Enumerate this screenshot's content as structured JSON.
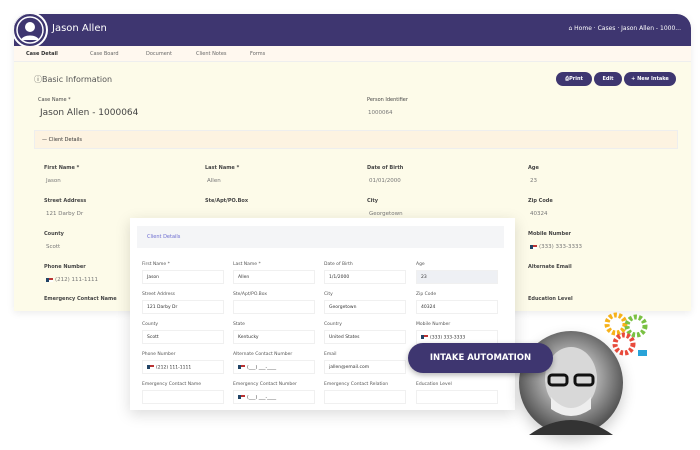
{
  "header": {
    "title": "Jason Allen",
    "breadcrumb": "⌂ Home · Cases · Jason Allen - 1000..."
  },
  "tabs": [
    {
      "label": "Case Detail"
    },
    {
      "label": "Case Board"
    },
    {
      "label": "Document"
    },
    {
      "label": "Client Notes"
    },
    {
      "label": "Forms"
    }
  ],
  "section": {
    "title": "Basic Information",
    "buttons": {
      "print": "⎙Print",
      "edit": "Edit",
      "new_intake": "+ New Intake"
    }
  },
  "case": {
    "name_label": "Case Name *",
    "name": "Jason Allen - 1000064",
    "pid_label": "Person Identifier",
    "pid": "1000064"
  },
  "client_details_label": "Client Details",
  "bg_fields": [
    {
      "label": "First Name *",
      "value": "Jason"
    },
    {
      "label": "Last Name *",
      "value": "Allen"
    },
    {
      "label": "Date of Birth",
      "value": "01/01/2000"
    },
    {
      "label": "Age",
      "value": "23"
    },
    {
      "label": "Street Address",
      "value": "121 Darby Dr"
    },
    {
      "label": "Ste/Apt/PO.Box",
      "value": ""
    },
    {
      "label": "City",
      "value": "Georgetown"
    },
    {
      "label": "Zip Code",
      "value": "40324"
    },
    {
      "label": "County",
      "value": "Scott"
    },
    {
      "label": "",
      "value": ""
    },
    {
      "label": "",
      "value": ""
    },
    {
      "label": "Mobile Number",
      "value": "(333) 333-3333"
    },
    {
      "label": "Phone Number",
      "value": "(212) 111-1111"
    },
    {
      "label": "",
      "value": ""
    },
    {
      "label": "",
      "value": ""
    },
    {
      "label": "Alternate Email",
      "value": ""
    },
    {
      "label": "Emergency Contact Name",
      "value": ""
    },
    {
      "label": "",
      "value": ""
    },
    {
      "label": "",
      "value": ""
    },
    {
      "label": "Education Level",
      "value": ""
    }
  ],
  "card": {
    "title": "Client Details",
    "fields": [
      {
        "label": "First Name *",
        "value": "Jason"
      },
      {
        "label": "Last Name *",
        "value": "Allen"
      },
      {
        "label": "Date of Birth",
        "value": "1/1/2000"
      },
      {
        "label": "Age",
        "value": "23"
      },
      {
        "label": "Street Address",
        "value": "121 Darby Dr"
      },
      {
        "label": "Ste/Apt/PO.Box",
        "value": ""
      },
      {
        "label": "City",
        "value": "Georgetown"
      },
      {
        "label": "Zip Code",
        "value": "40324"
      },
      {
        "label": "County",
        "value": "Scott"
      },
      {
        "label": "State",
        "value": "Kentucky"
      },
      {
        "label": "Country",
        "value": "United States"
      },
      {
        "label": "Mobile Number",
        "value": "(333) 333-3333"
      },
      {
        "label": "Phone Number",
        "value": "(212) 111-1111"
      },
      {
        "label": "Alternate Contact Number",
        "value": "(___) ___-____"
      },
      {
        "label": "Email",
        "value": "jallen@email.com"
      },
      {
        "label": "",
        "value": ""
      },
      {
        "label": "Emergency Contact Name",
        "value": ""
      },
      {
        "label": "Emergency Contact Number",
        "value": "(___) ___-____"
      },
      {
        "label": "Emergency Contact Relation",
        "value": ""
      },
      {
        "label": "Education Level",
        "value": ""
      }
    ]
  },
  "badge": "INTAKE AUTOMATION",
  "colors": {
    "brand": "#3e3670",
    "background": "#fdfbe9"
  }
}
